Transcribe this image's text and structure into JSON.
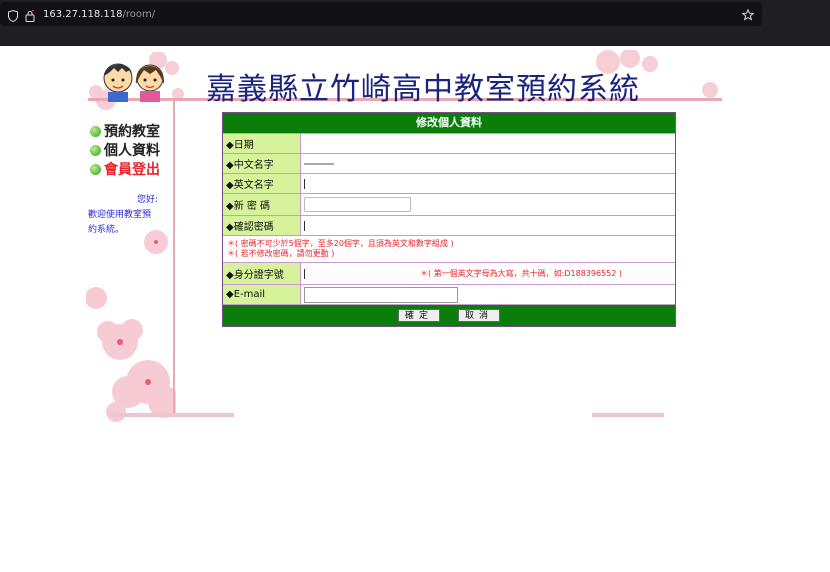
{
  "browser": {
    "url_host": "163.27.118.118",
    "url_path": "/room/"
  },
  "site": {
    "title": "嘉義縣立竹崎高中教室預約系統"
  },
  "menu": {
    "items": [
      {
        "label": "預約教室"
      },
      {
        "label": "個人資料"
      },
      {
        "label": "會員登出"
      }
    ]
  },
  "greeting": {
    "line1": "您好:",
    "line2": "歡迎使用教室預",
    "line3": "約系統。"
  },
  "form": {
    "header": "修改個人資料",
    "fields": {
      "date": "◆日期",
      "cn_name": "◆中文名字",
      "en_name": "◆英文名字",
      "new_pw": "◆新 密 碼",
      "confirm_pw": "◆確認密碼",
      "id_number": "◆身分證字號",
      "email": "◆E-mail"
    },
    "notes": {
      "pw_rule": "＊( 密碼不可少於5個字，至多20個字，且須為英文和數字組成 )",
      "pw_keep": "＊( 若不修改密碼，請勿更動 )",
      "id_rule": "＊( 第一個英文字母為大寫，共十碼，如:D188396552 )"
    },
    "buttons": {
      "ok": "確定",
      "cancel": "取消"
    }
  },
  "colors": {
    "header_green": "#0a7d0a",
    "label_bg": "#d6f29a",
    "title_navy": "#1a237e",
    "note_red": "#e8242c"
  }
}
